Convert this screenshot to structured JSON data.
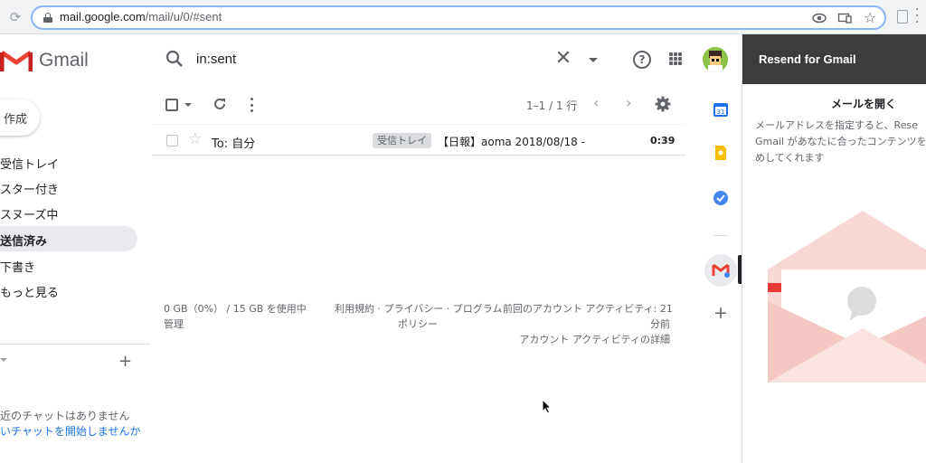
{
  "browser": {
    "url_host": "mail.google.com",
    "url_path": "/mail/u/0/#sent"
  },
  "header": {
    "app_name": "Gmail",
    "search_query": "in:sent"
  },
  "compose": {
    "label": "作成"
  },
  "nav": {
    "items": [
      {
        "label": "受信トレイ",
        "active": false
      },
      {
        "label": "スター付き",
        "active": false
      },
      {
        "label": "スヌーズ中",
        "active": false
      },
      {
        "label": "送信済み",
        "active": true
      },
      {
        "label": "下書き",
        "active": false
      },
      {
        "label": "もっと見る",
        "active": false
      }
    ]
  },
  "chat": {
    "empty_text": "近のチャットはありません",
    "start_link": "いチャットを開始しませんか"
  },
  "toolbar": {
    "page_range": "1–1 / 1 行"
  },
  "mails": [
    {
      "sender": "To: 自分",
      "label": "受信トレイ",
      "subject": "【日報】aoma 2018/08/18 -",
      "time": "0:39"
    }
  ],
  "footer": {
    "storage_line1": "0 GB（0%） / 15 GB を使用中",
    "storage_line2": "管理",
    "links_line1": "利用規約 · プライバシー · プログラム",
    "links_line2": "ポリシー",
    "activity_line1": "前回のアカウント アクティビティ: 21",
    "activity_line2": "分前",
    "activity_line3": "アカウント アクティビティの詳細"
  },
  "resend": {
    "title": "Resend for Gmail",
    "heading": "メールを開く",
    "desc_line1": "メールアドレスを指定すると、Rese",
    "desc_line2": "Gmail があなたに合ったコンテンツを",
    "desc_line3": "めしてくれます"
  },
  "colors": {
    "accent_blue": "#1a73e8",
    "gmail_red": "#ea4335",
    "nav_active_bg": "#e8eaed",
    "resend_header_bg": "#3c3c3c",
    "envelope_pink": "#f4c7c3"
  }
}
